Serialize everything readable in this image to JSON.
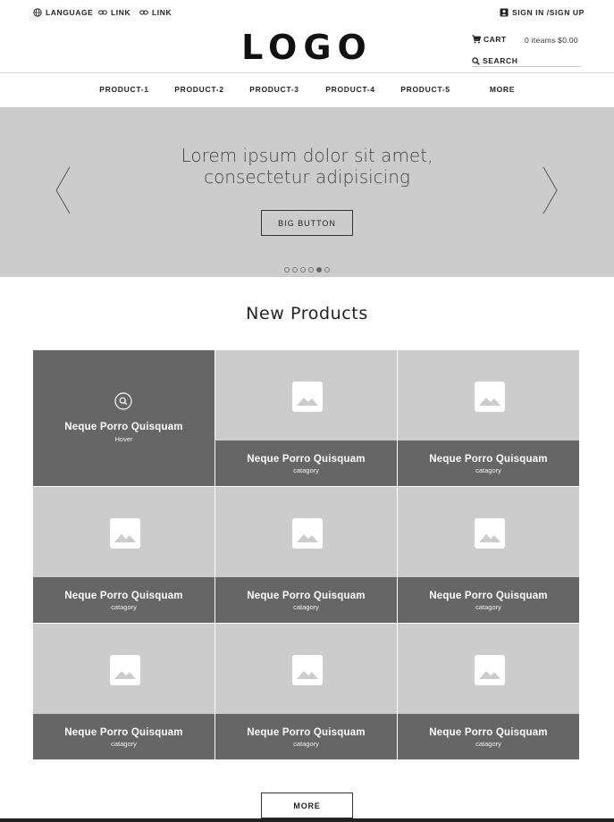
{
  "topbar": {
    "language": "LANGUAGE",
    "link1": "LINK",
    "link2": "LINK",
    "signin": "SIGN IN /SIGN UP"
  },
  "header": {
    "logo": "LOGO",
    "cart_label": "CART",
    "cart_total": "0 iteams $0.00",
    "search_label": "SEARCH"
  },
  "nav": {
    "items": [
      "PRODUCT-1",
      "PRODUCT-2",
      "PRODUCT-3",
      "PRODUCT-4",
      "PRODUCT-5",
      "MORE"
    ]
  },
  "hero": {
    "line1": "Lorem ipsum dolor sit amet,",
    "line2": "consectetur adipisicing",
    "button": "BIG BUTTON",
    "dots_count": 6,
    "active_dot": 5
  },
  "section": {
    "title": "New Products"
  },
  "products": [
    {
      "title": "Neque Porro Quisquam",
      "sub": "Hover",
      "state": "hover"
    },
    {
      "title": "Neque Porro Quisquam",
      "sub": "catagory",
      "state": "normal"
    },
    {
      "title": "Neque Porro Quisquam",
      "sub": "catagory",
      "state": "normal"
    },
    {
      "title": "Neque Porro Quisquam",
      "sub": "catagory",
      "state": "normal"
    },
    {
      "title": "Neque Porro Quisquam",
      "sub": "catagory",
      "state": "normal"
    },
    {
      "title": "Neque Porro Quisquam",
      "sub": "catagory",
      "state": "normal"
    },
    {
      "title": "Neque Porro Quisquam",
      "sub": "catagory",
      "state": "normal"
    },
    {
      "title": "Neque Porro Quisquam",
      "sub": "catagory",
      "state": "normal"
    },
    {
      "title": "Neque Porro Quisquam",
      "sub": "catagory",
      "state": "normal"
    }
  ],
  "footer": {
    "more_button": "MORE"
  },
  "colors": {
    "hero_bg": "#cccccc",
    "tile_bg": "#cccccc",
    "caption_bg": "#666666",
    "text_dark": "#222222"
  },
  "icons": {
    "language": "globe-icon",
    "link": "link-icon",
    "account": "account-icon",
    "cart": "cart-icon",
    "search": "search-icon",
    "image": "image-placeholder-icon",
    "zoom": "zoom-icon",
    "prev": "chevron-left-icon",
    "next": "chevron-right-icon"
  }
}
